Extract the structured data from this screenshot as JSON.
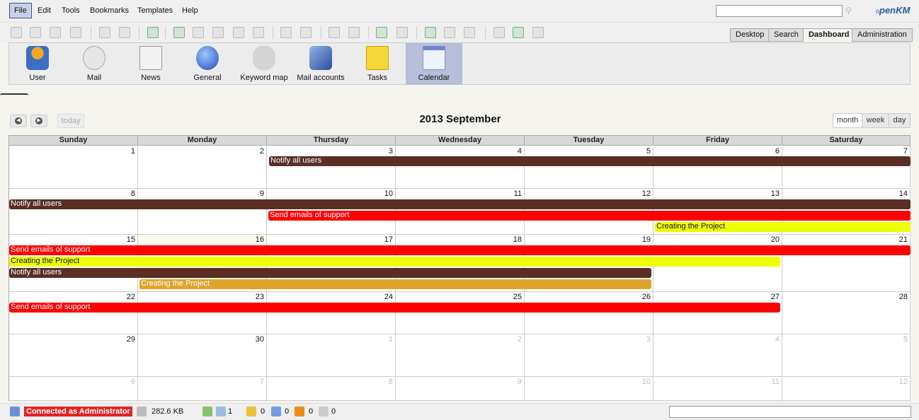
{
  "menu": [
    "File",
    "Edit",
    "Tools",
    "Bookmarks",
    "Templates",
    "Help"
  ],
  "search": {
    "placeholder": ""
  },
  "logo": {
    "main": "penKM",
    "prefix": "o"
  },
  "tabs": [
    "Desktop",
    "Search",
    "Dashboard",
    "Administration"
  ],
  "dashboard": [
    "User",
    "Mail",
    "News",
    "General",
    "Keyword map",
    "Mail accounts",
    "Tasks",
    "Calendar"
  ],
  "calendar": {
    "title": "2013 September",
    "today_label": "today",
    "views": [
      "month",
      "week",
      "day"
    ],
    "days_of_week": [
      "Sunday",
      "Monday",
      "Thursday",
      "Wednesday",
      "Tuesday",
      "Friday",
      "Saturday"
    ],
    "weeks": [
      [
        "1",
        "2",
        "3",
        "4",
        "5",
        "6",
        "7"
      ],
      [
        "8",
        "9",
        "10",
        "11",
        "12",
        "13",
        "14"
      ],
      [
        "15",
        "16",
        "17",
        "18",
        "19",
        "20",
        "21"
      ],
      [
        "22",
        "23",
        "24",
        "25",
        "26",
        "27",
        "28"
      ],
      [
        "29",
        "30",
        "1",
        "2",
        "3",
        "4",
        "5"
      ],
      [
        "6",
        "7",
        "8",
        "9",
        "10",
        "11",
        "12"
      ]
    ],
    "events": [
      {
        "title": "Notify all users",
        "color": "#5a2e24",
        "text_color": "#ffffff"
      },
      {
        "title": "Notify all users",
        "color": "#5a2e24",
        "text_color": "#ffffff"
      },
      {
        "title": "Send emails of support",
        "color": "#ff0000",
        "text_color": "#ffffff"
      },
      {
        "title": "Creating the Project",
        "color": "#eeff00",
        "text_color": "#111111"
      },
      {
        "title": "Send emails of support",
        "color": "#ff0000",
        "text_color": "#ffffff"
      },
      {
        "title": "Creating the Project",
        "color": "#eeff00",
        "text_color": "#111111"
      },
      {
        "title": "Notify all users",
        "color": "#5a2e24",
        "text_color": "#ffffff"
      },
      {
        "title": "Creating the Project",
        "color": "#e0a32a",
        "text_color": "#ffffff"
      },
      {
        "title": "Send emails of support",
        "color": "#ff0000",
        "text_color": "#ffffff"
      }
    ]
  },
  "status": {
    "connected": "Connected as Administrator",
    "size": "282.6 KB",
    "counts": [
      "1",
      "0",
      "0",
      "0",
      "0"
    ]
  }
}
